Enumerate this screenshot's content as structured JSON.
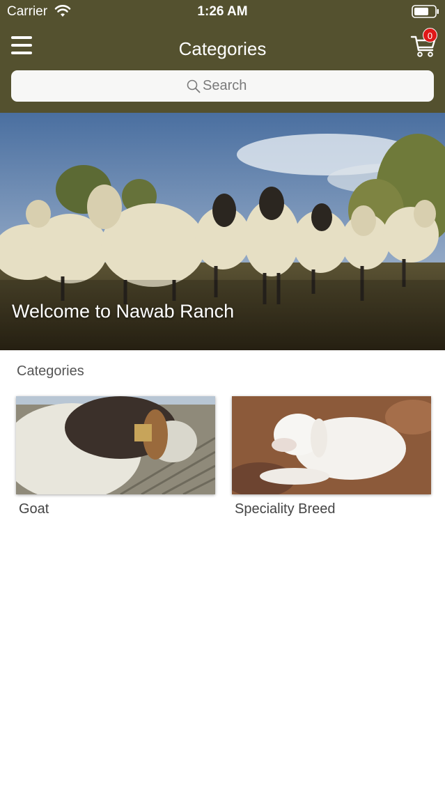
{
  "status_bar": {
    "carrier": "Carrier",
    "time": "1:26 AM"
  },
  "nav": {
    "title": "Categories",
    "cart_count": "0"
  },
  "search": {
    "placeholder": "Search"
  },
  "hero": {
    "caption": "Welcome to Nawab Ranch"
  },
  "categories": {
    "heading": "Categories",
    "items": [
      {
        "label": "Goat"
      },
      {
        "label": "Speciality Breed"
      }
    ]
  },
  "colors": {
    "header_bg": "#54512f",
    "badge": "#e01818"
  }
}
